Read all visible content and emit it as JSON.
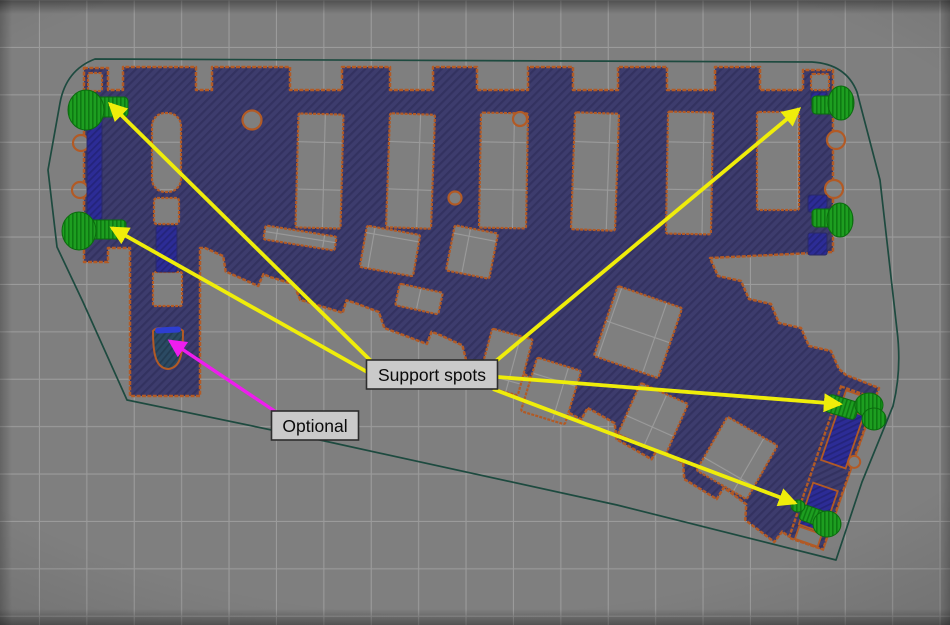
{
  "view": {
    "name": "slicer-print-bed-top-view",
    "description": "Top view of a sliced curved rail-track switch model on a print bed with annotated support spots"
  },
  "labels": {
    "support_spots": "Support spots",
    "optional": "Optional"
  },
  "annotations": {
    "support_spots": {
      "label": "Support spots",
      "arrow_count": 5,
      "targets": [
        "left-top-connector",
        "left-middle-connector",
        "right-top-connector",
        "bottom-right-connector-side",
        "bottom-right-connector-end"
      ]
    },
    "optional": {
      "label": "Optional",
      "arrow_count": 1,
      "targets": [
        "leg-pocket"
      ]
    }
  },
  "support_spot_count": 6,
  "colors": {
    "bed_background": "#7f7f7f",
    "grid_line": "#9b9b9b",
    "model_fill": "#3d3c6d",
    "model_hatch": "#333260",
    "perimeter_outline": "#b25a25",
    "support_green": "#1d9e20",
    "support_green_hatch": "#0e7a12",
    "infill_blue": "#2c2c96",
    "infill_blue_hatch": "#24247c",
    "pocket_teal": "#2b4a63",
    "pocket_teal_hatch": "#223c52",
    "pocket_lip_blue": "#2e3ed0",
    "skirt_outline": "#1d4a3f",
    "arrow_yellow": "#efed0a",
    "arrow_magenta": "#ee1dee",
    "label_background": "#cacaca",
    "label_border": "#2d2d2d",
    "label_text": "#0a0a0a"
  }
}
